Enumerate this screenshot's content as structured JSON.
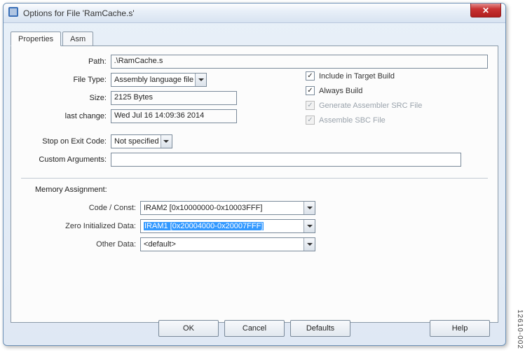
{
  "window": {
    "title": "Options for File 'RamCache.s'"
  },
  "tabs": {
    "properties": "Properties",
    "asm": "Asm"
  },
  "fields": {
    "path_label": "Path:",
    "path_value": ".\\RamCache.s",
    "filetype_label": "File Type:",
    "filetype_value": "Assembly language file",
    "size_label": "Size:",
    "size_value": "2125 Bytes",
    "lastchange_label": "last change:",
    "lastchange_value": "Wed Jul 16 14:09:36 2014",
    "stopexit_label": "Stop on Exit Code:",
    "stopexit_value": "Not specified",
    "customargs_label": "Custom Arguments:",
    "customargs_value": ""
  },
  "checks": {
    "include_build": "Include in Target Build",
    "always_build": "Always Build",
    "gen_src": "Generate Assembler SRC File",
    "asm_sbc": "Assemble SBC File"
  },
  "memory": {
    "title": "Memory Assignment:",
    "code_label": "Code / Const:",
    "code_value": "IRAM2 [0x10000000-0x10003FFF]",
    "zid_label": "Zero Initialized Data:",
    "zid_value": "IRAM1 [0x20004000-0x20007FFF]",
    "other_label": "Other Data:",
    "other_value": "<default>"
  },
  "buttons": {
    "ok": "OK",
    "cancel": "Cancel",
    "defaults": "Defaults",
    "help": "Help"
  },
  "ref": "12610-002"
}
